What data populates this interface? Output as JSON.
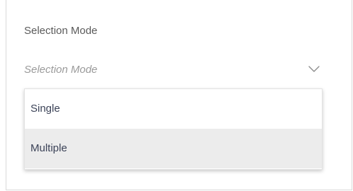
{
  "field": {
    "label": "Selection Mode",
    "placeholder": "Selection Mode",
    "icon": "chevron-down-icon"
  },
  "dropdown": {
    "options": [
      {
        "label": "Single",
        "highlighted": false
      },
      {
        "label": "Multiple",
        "highlighted": true
      }
    ]
  },
  "colors": {
    "label_text": "#5a5a5a",
    "placeholder_text": "#9a9a9a",
    "option_text": "#3b4257",
    "highlight_bg": "#ececec",
    "border": "#d9d9d9"
  }
}
